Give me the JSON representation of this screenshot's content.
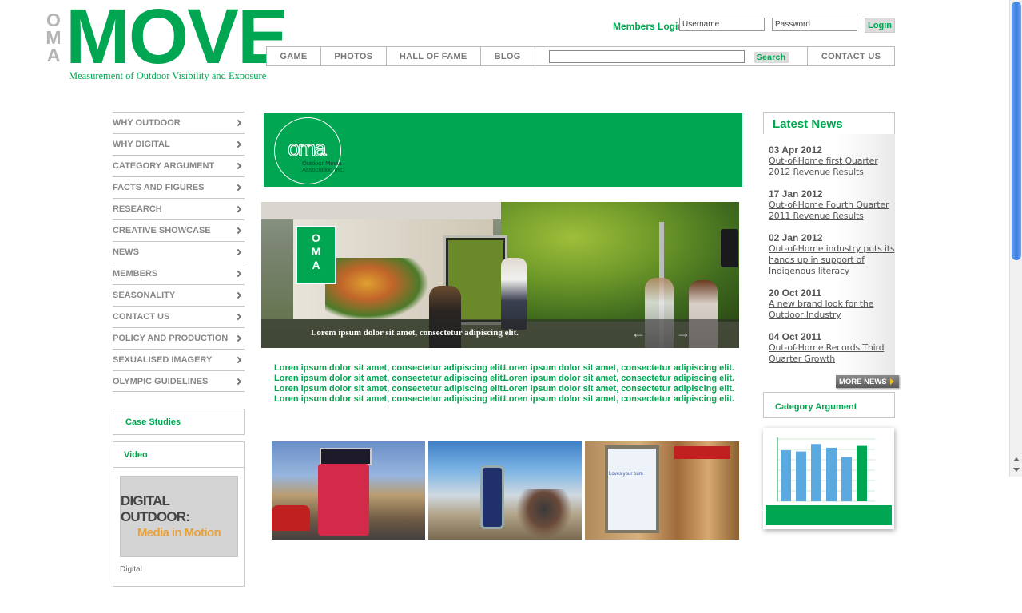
{
  "logo": {
    "oma_letters": [
      "O",
      "M",
      "A"
    ],
    "title": "MOVE",
    "tagline": "Measurement of Outdoor Visibility and Exposure"
  },
  "login": {
    "label": "Members Login",
    "username_placeholder": "Username",
    "password_placeholder": "Password",
    "button": "Login"
  },
  "topnav": {
    "game": "GAME",
    "photos": "PHOTOS",
    "hall_of_fame": "HALL OF FAME",
    "blog": "BLOG",
    "search_value": "",
    "search_button": "Search",
    "contact": "CONTACT US"
  },
  "sidebar": {
    "items": [
      "WHY OUTDOOR",
      "WHY DIGITAL",
      "CATEGORY ARGUMENT",
      "FACTS AND FIGURES",
      "RESEARCH",
      "CREATIVE SHOWCASE",
      "NEWS",
      "MEMBERS",
      "SEASONALITY",
      "CONTACT US",
      "POLICY AND PRODUCTION",
      "SEXUALISED IMAGERY",
      "OLYMPIC GUIDELINES"
    ],
    "case_studies": "Case Studies",
    "video": {
      "title": "Video",
      "thumb_line1": "DIGITAL OUTDOOR:",
      "thumb_line2": "Media in Motion",
      "caption": "Digital"
    }
  },
  "banner": {
    "mark": "oma",
    "name_line1": "Outdoor Media",
    "name_line2": "Association Inc."
  },
  "hero": {
    "sign_letters": [
      "O",
      "M",
      "A"
    ],
    "caption": "Lorem ipsum dolor sit amet, consectetur adipiscing elit.",
    "prev_glyph": "←",
    "next_glyph": "→"
  },
  "lorem": {
    "left": [
      "Loren ipsum dolor sit amet, consectetur adipiscing elit.",
      "Loren ipsum dolor sit amet, consectetur adipiscing elit.",
      "Loren ipsum dolor sit amet, consectetur adipiscing elit.",
      "Loren ipsum dolor sit amet, consectetur adipiscing elit."
    ],
    "right": [
      "Loren ipsum dolor sit amet, consectetur adipiscing elit.",
      "Loren ipsum dolor sit amet, consectetur adipiscing elit.",
      "Loren ipsum dolor sit amet, consectetur adipiscing elit.",
      "Loren ipsum dolor sit amet, consectetur adipiscing elit."
    ]
  },
  "thumbnails": {
    "t3_billboard_text": "Loves your bum"
  },
  "news": {
    "title": "Latest News",
    "items": [
      {
        "date": "03 Apr 2012",
        "line1": "Out-of-Home first Quarter",
        "line2": "2012 Revenue Results",
        "line3": ""
      },
      {
        "date": "17 Jan 2012",
        "line1": "Out-of-Home Fourth Quarter",
        "line2": "2011 Revenue Results",
        "line3": ""
      },
      {
        "date": "02 Jan 2012",
        "line1": "Out-of-Home industry puts its",
        "line2": "hands up in support of",
        "line3": "Indigenous literacy"
      },
      {
        "date": "20 Oct 2011",
        "line1": "A new brand look for the",
        "line2": "Outdoor Industry",
        "line3": ""
      },
      {
        "date": "04 Oct 2011",
        "line1": "Out-of-Home Records Third",
        "line2": "Quarter Growth",
        "line3": ""
      }
    ],
    "more": "MORE NEWS"
  },
  "category": {
    "title": "Category Argument",
    "bars": [
      0.82,
      0.8,
      0.92,
      0.86,
      0.71,
      0.89
    ],
    "highlight_index": 5
  },
  "colors": {
    "brand_green": "#00a651",
    "nav_text": "#777777",
    "bar_blue": "#5aa9e0"
  }
}
